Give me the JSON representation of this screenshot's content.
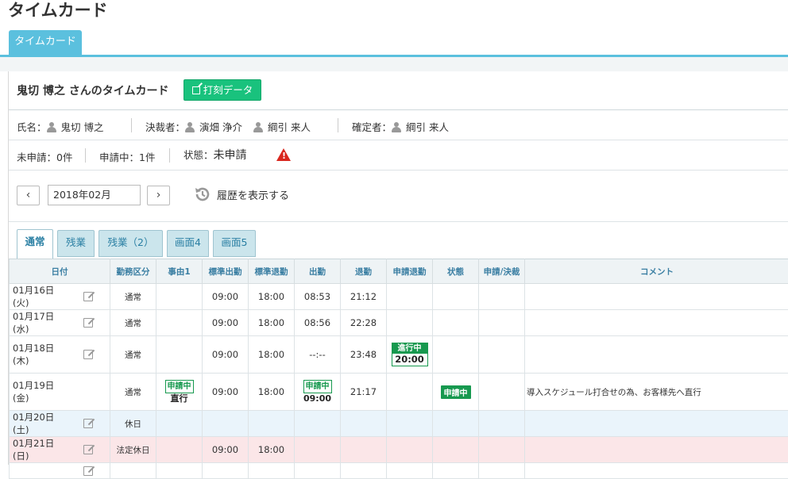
{
  "page_title": "タイムカード",
  "top_tab": "タイムカード",
  "panel": {
    "title": "鬼切 博之 さんのタイムカード",
    "stamp_button": "打刻データ"
  },
  "info": {
    "name_label": "氏名：",
    "name_value": "鬼切 博之",
    "approver_label": "決裁者：",
    "approver1": "演畑 浄介",
    "approver2": "綱引 来人",
    "confirmer_label": "確定者：",
    "confirmer": "綱引 来人"
  },
  "status": {
    "unapplied": "未申請：0件",
    "applying": "申請中：1件",
    "state_label": "状態：",
    "state_value": "未申請",
    "warning_icon": "warning-icon"
  },
  "nav": {
    "prev": "‹",
    "next": "›",
    "month": "2018年02月",
    "history": "履歴を表示する"
  },
  "tabs": [
    "通常",
    "残業",
    "残業（2）",
    "画面4",
    "画面5"
  ],
  "table": {
    "headers": [
      "日付",
      "勤務区分",
      "事由1",
      "標準出勤",
      "標準退勤",
      "出勤",
      "退勤",
      "申請退勤",
      "状態",
      "申請/決裁",
      "コメント"
    ],
    "rows": [
      {
        "date": "01月16日(火)",
        "type": "通常",
        "std_in": "09:00",
        "std_out": "18:00",
        "in": "08:53",
        "out": "21:12",
        "comment": ""
      },
      {
        "date": "01月17日(水)",
        "type": "通常",
        "std_in": "09:00",
        "std_out": "18:00",
        "in": "08:56",
        "out": "22:28",
        "comment": ""
      },
      {
        "date": "01月18日(木)",
        "type": "通常",
        "std_in": "09:00",
        "std_out": "18:00",
        "in": "--:--",
        "out": "23:48",
        "req_out_badge": "進行中",
        "req_out_time": "20:00",
        "comment": ""
      },
      {
        "date": "01月19日(金)",
        "type": "通常",
        "reason_badge": "申請中",
        "reason_text": "直行",
        "std_in": "09:00",
        "std_out": "18:00",
        "in_badge": "申請中",
        "in_time": "09:00",
        "out": "21:17",
        "state_badge": "申請中",
        "comment": "導入スケジュール打合せの為、お客様先へ直行"
      },
      {
        "date": "01月20日(土)",
        "type": "休日",
        "std_in": "",
        "std_out": "",
        "in": "",
        "out": "",
        "comment": ""
      },
      {
        "date": "01月21日(日)",
        "type": "法定休日",
        "std_in": "09:00",
        "std_out": "18:00",
        "in": "",
        "out": "",
        "comment": ""
      }
    ]
  }
}
